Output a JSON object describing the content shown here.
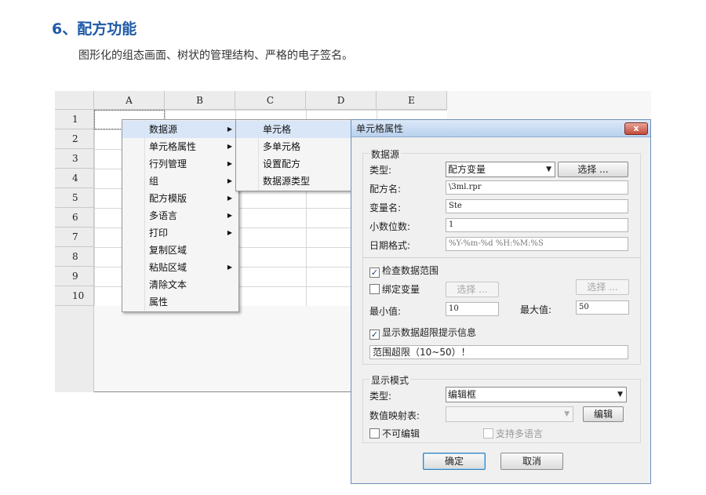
{
  "heading": "6、配方功能",
  "subtitle": "图形化的组态画面、树状的管理结构、严格的电子签名。",
  "sheet": {
    "columns": [
      "A",
      "B",
      "C",
      "D",
      "E"
    ],
    "rows": [
      "1",
      "2",
      "3",
      "4",
      "5",
      "6",
      "7",
      "8",
      "9",
      "10"
    ]
  },
  "context_menu": {
    "items": [
      {
        "label": "数据源",
        "submenu": true
      },
      {
        "label": "单元格属性",
        "submenu": true
      },
      {
        "label": "行列管理",
        "submenu": true
      },
      {
        "label": "组",
        "submenu": true
      },
      {
        "label": "配方模版",
        "submenu": true
      },
      {
        "label": "多语言",
        "submenu": true
      },
      {
        "label": "打印",
        "submenu": true
      },
      {
        "label": "复制区域",
        "submenu": false
      },
      {
        "label": "粘贴区域",
        "submenu": true
      },
      {
        "label": "清除文本",
        "submenu": false
      },
      {
        "label": "属性",
        "submenu": false
      }
    ],
    "arrow": "▶"
  },
  "submenu": {
    "items": [
      "单元格",
      "多单元格",
      "设置配方",
      "数据源类型"
    ]
  },
  "dialog": {
    "title": "单元格属性",
    "close": "x",
    "datasource": {
      "group_title": "数据源",
      "type_label": "类型:",
      "type_value": "配方变量",
      "select_button": "选择 ...",
      "recipe_name_label": "配方名:",
      "recipe_name_value": "\\3ml.rpr",
      "var_name_label": "变量名:",
      "var_name_value": "Ste",
      "decimals_label": "小数位数:",
      "decimals_value": "1",
      "date_format_label": "日期格式:",
      "date_format_value": "%Y-%m-%d %H:%M:%S",
      "check_range_label": "检查数据范围",
      "check_range_checked": true,
      "bind_var_label": "绑定变量",
      "bind_var_checked": false,
      "bind_select_button": "选择 ...",
      "bind_select_button_2": "选择 ...",
      "min_label": "最小值:",
      "min_value": "10",
      "max_label": "最大值:",
      "max_value": "50",
      "show_limit_label": "显示数据超限提示信息",
      "show_limit_checked": true,
      "limit_message": "范围超限（10~50）！"
    },
    "display": {
      "group_title": "显示模式",
      "type_label": "类型:",
      "type_value": "编辑框",
      "map_label": "数值映射表:",
      "map_value": "",
      "edit_button": "编辑",
      "readonly_label": "不可编辑",
      "readonly_checked": false,
      "multilang_label": "支持多语言",
      "multilang_checked": false
    },
    "ok_button": "确定",
    "cancel_button": "取消",
    "check_glyph": "✓",
    "dropdown_glyph": "▼"
  }
}
